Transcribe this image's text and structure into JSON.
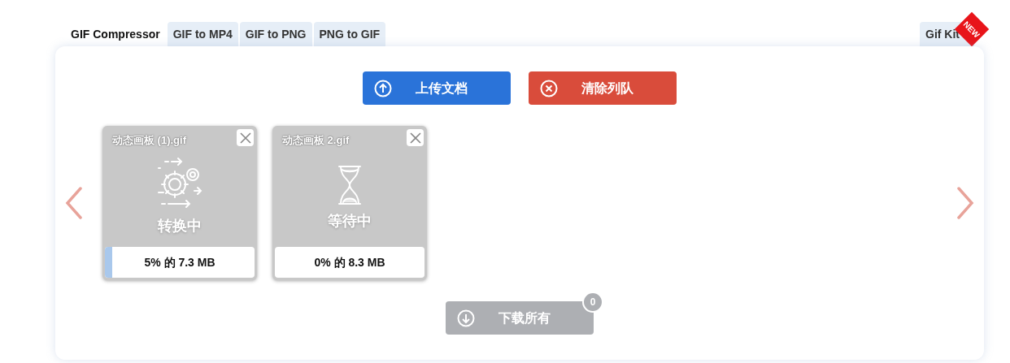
{
  "tabs": [
    {
      "label": "GIF Compressor",
      "selected": true
    },
    {
      "label": "GIF to MP4",
      "selected": false
    },
    {
      "label": "GIF to PNG",
      "selected": false
    },
    {
      "label": "PNG to GIF",
      "selected": false
    }
  ],
  "right_tab": {
    "label": "Gif Kit",
    "badge": "NEW",
    "selected": false
  },
  "actions": [
    {
      "label": "上传文档",
      "kind": "upload"
    },
    {
      "label": "清除列队",
      "kind": "clear"
    }
  ],
  "files": [
    {
      "name": "动态画板 (1).gif",
      "kind": "converting",
      "status": "转换中",
      "progress": "5% 的 7.3 MB",
      "level": 0.05
    },
    {
      "name": "动态画板 2.gif",
      "kind": "waiting",
      "status": "等待中",
      "progress": "0% 的 8.3 MB",
      "level": 0
    }
  ],
  "download": {
    "label": "下载所有",
    "count": "0",
    "disabled": true
  }
}
